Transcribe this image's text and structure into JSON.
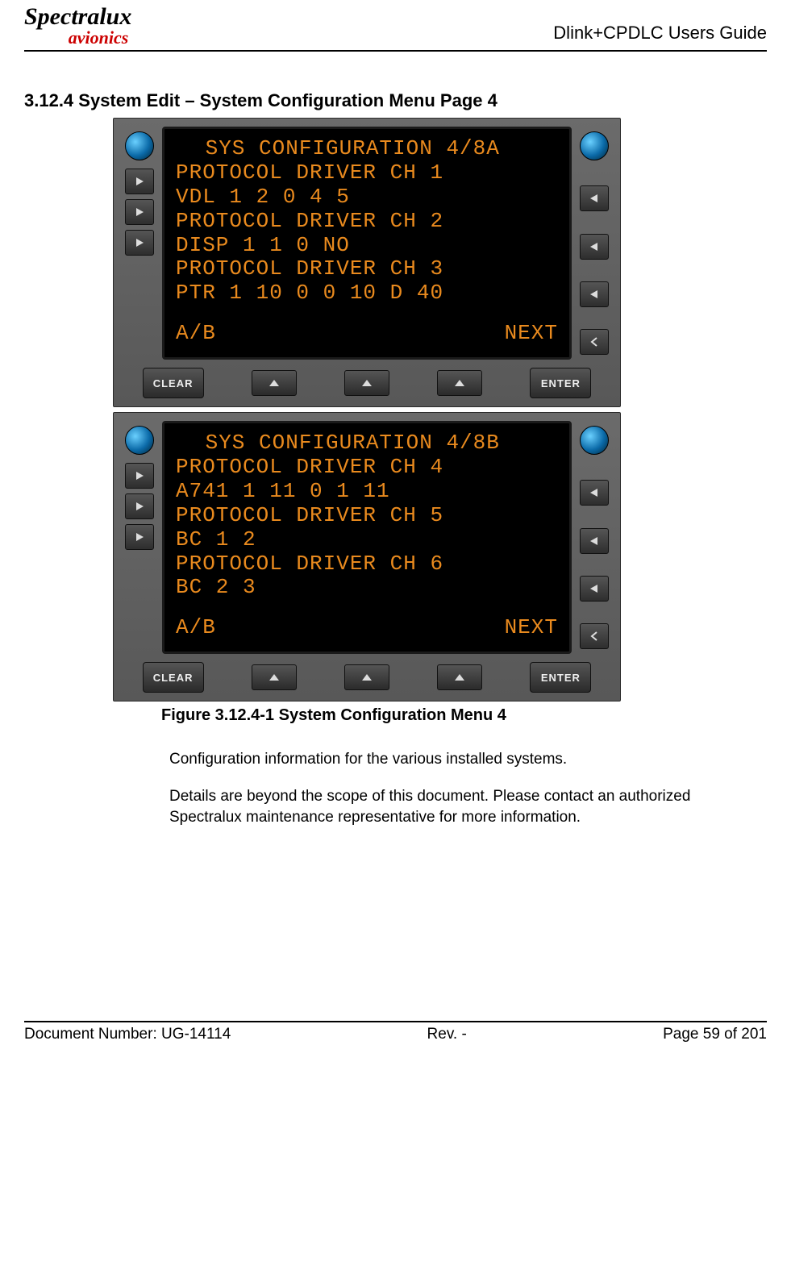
{
  "header": {
    "logo_line1": "Spectralux",
    "logo_line2": "avionics",
    "guide_title": "Dlink+CPDLC Users Guide"
  },
  "section_heading": "3.12.4 System Edit – System Configuration Menu Page 4",
  "devices": [
    {
      "title": " SYS CONFIGURATION 4/8A",
      "lines": [
        "PROTOCOL DRIVER CH 1",
        "VDL 1 2 0 4 5",
        "PROTOCOL DRIVER CH 2",
        "DISP 1 1 0 NO",
        "PROTOCOL DRIVER CH 3",
        "PTR 1 10 0 0 10 D 40"
      ],
      "footer_left": "A/B",
      "footer_right": "NEXT"
    },
    {
      "title": " SYS CONFIGURATION 4/8B",
      "lines": [
        "PROTOCOL DRIVER CH 4",
        "A741 1 11 0 1 11",
        "PROTOCOL DRIVER CH 5",
        "BC 1 2",
        "PROTOCOL DRIVER CH 6",
        "BC 2 3"
      ],
      "footer_left": "A/B",
      "footer_right": "NEXT"
    }
  ],
  "buttons": {
    "clear": "CLEAR",
    "enter": "ENTER"
  },
  "caption": "Figure 3.12.4-1 System Configuration Menu 4",
  "paragraphs": [
    "Configuration information for the various installed systems.",
    "Details are beyond the scope of this document.  Please contact an authorized Spectralux maintenance representative for more information."
  ],
  "footer": {
    "left": "Document Number:  UG-14114",
    "middle": "Rev. -",
    "right": "Page 59 of 201"
  }
}
